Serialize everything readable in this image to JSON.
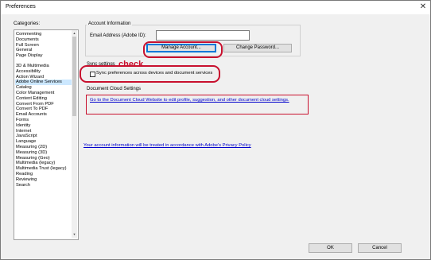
{
  "window": {
    "title": "Preferences",
    "close_glyph": "✕"
  },
  "categories": {
    "label": "Categories:",
    "items": [
      {
        "label": "Commenting"
      },
      {
        "label": "Documents"
      },
      {
        "label": "Full Screen"
      },
      {
        "label": "General"
      },
      {
        "label": "Page Display"
      },
      {
        "label": "3D & Multimedia",
        "gap": true
      },
      {
        "label": "Accessibility"
      },
      {
        "label": "Action Wizard"
      },
      {
        "label": "Adobe Online Services",
        "selected": true
      },
      {
        "label": "Catalog"
      },
      {
        "label": "Color Management"
      },
      {
        "label": "Content Editing"
      },
      {
        "label": "Convert From PDF"
      },
      {
        "label": "Convert To PDF"
      },
      {
        "label": "Email Accounts"
      },
      {
        "label": "Forms"
      },
      {
        "label": "Identity"
      },
      {
        "label": "Internet"
      },
      {
        "label": "JavaScript"
      },
      {
        "label": "Language"
      },
      {
        "label": "Measuring (2D)"
      },
      {
        "label": "Measuring (3D)"
      },
      {
        "label": "Measuring (Geo)"
      },
      {
        "label": "Multimedia (legacy)"
      },
      {
        "label": "Multimedia Trust (legacy)"
      },
      {
        "label": "Reading"
      },
      {
        "label": "Reviewing"
      },
      {
        "label": "Search"
      }
    ]
  },
  "account": {
    "legend": "Account Information",
    "email_label": "Email Address (Adobe ID):",
    "email_value": "",
    "manage_label": "Manage Account...",
    "change_password_label": "Change Password..."
  },
  "annotation": {
    "check_text": "check",
    "color": "#c8102e"
  },
  "sync": {
    "legend": "Sync settings",
    "checkbox_label": "Sync preferences across devices and document services",
    "checked": false
  },
  "document_cloud": {
    "legend": "Document Cloud Settings",
    "link_text": "Go to the Document Cloud Website to edit profile, suggestion, and other document cloud settings."
  },
  "privacy": {
    "link_text": "Your account information will be treated in accordance with Adobe's Privacy Policy"
  },
  "footer": {
    "ok_label": "OK",
    "cancel_label": "Cancel"
  },
  "colors": {
    "link": "#0000cc",
    "selection": "#cce8ff",
    "focus": "#0078d7"
  }
}
